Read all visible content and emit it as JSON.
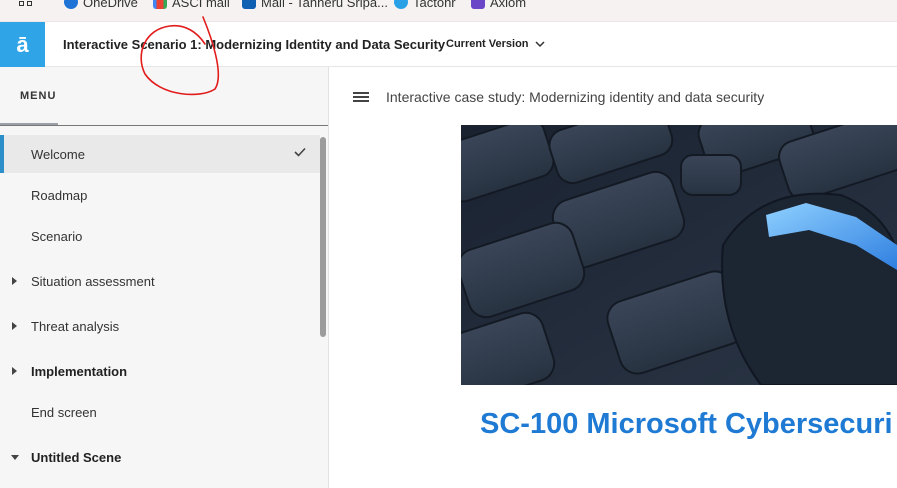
{
  "bookmarks": [
    {
      "label": "OneDrive",
      "icon": "onedrive-icon",
      "color": "#1e73d6"
    },
    {
      "label": "ASCI mail",
      "icon": "gmail-icon",
      "color": "#d93025"
    },
    {
      "label": "Mail - Tanneru Sripa...",
      "icon": "outlook-icon",
      "color": "#0f5fb3"
    },
    {
      "label": "Tactonr",
      "icon": "tactonr-icon",
      "color": "#2aa0e6"
    },
    {
      "label": "Axiom",
      "icon": "axiom-icon",
      "color": "#6b47c8"
    }
  ],
  "header": {
    "logo": "ā",
    "title": "Interactive Scenario 1: Modernizing Identity and Data Security",
    "version_label": "Current Version"
  },
  "sidebar": {
    "menu_label": "MENU",
    "items": [
      {
        "label": "Welcome",
        "active": true,
        "checked": true
      },
      {
        "label": "Roadmap"
      },
      {
        "label": "Scenario"
      },
      {
        "label": "Situation assessment",
        "caret": "right"
      },
      {
        "label": "Threat analysis",
        "caret": "right"
      },
      {
        "label": "Implementation",
        "caret": "right",
        "bold": true
      },
      {
        "label": "End screen"
      },
      {
        "label": "Untitled Scene",
        "caret": "down",
        "bold": true
      }
    ]
  },
  "main": {
    "case_title": "Interactive case study: Modernizing identity and data security",
    "heading": "SC-100 Microsoft Cybersecuri"
  },
  "colors": {
    "accent": "#2fa4e7",
    "heading_blue": "#1f7ad4",
    "annotation_red": "#e21c1c"
  }
}
